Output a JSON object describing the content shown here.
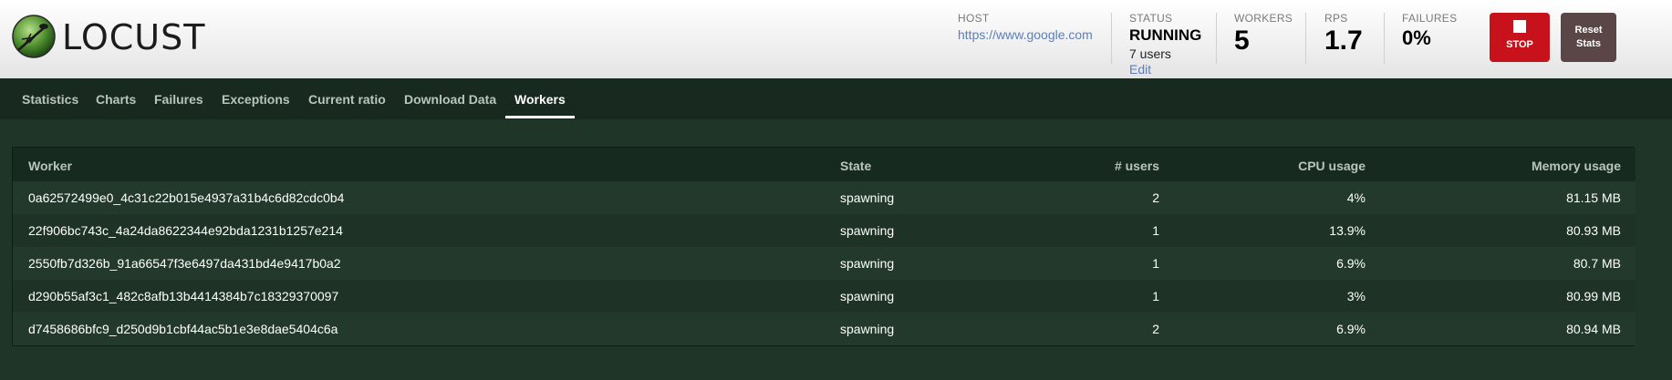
{
  "app": {
    "logo_text": "LOCUST"
  },
  "header": {
    "host": {
      "label": "HOST",
      "value": "https://www.google.com"
    },
    "status": {
      "label": "STATUS",
      "value": "RUNNING",
      "users": "7 users",
      "edit": "Edit"
    },
    "workers": {
      "label": "WORKERS",
      "value": "5"
    },
    "rps": {
      "label": "RPS",
      "value": "1.7"
    },
    "failures": {
      "label": "FAILURES",
      "value": "0%"
    },
    "stop_label": "STOP",
    "reset_label_line1": "Reset",
    "reset_label_line2": "Stats"
  },
  "colors": {
    "stop": "#c8121b",
    "reset": "#5a4646",
    "link": "#5c7fb8",
    "background": "#1f3528"
  },
  "tabs": [
    {
      "label": "Statistics"
    },
    {
      "label": "Charts"
    },
    {
      "label": "Failures"
    },
    {
      "label": "Exceptions"
    },
    {
      "label": "Current ratio"
    },
    {
      "label": "Download Data"
    },
    {
      "label": "Workers",
      "active": true
    }
  ],
  "table": {
    "columns": [
      "Worker",
      "State",
      "# users",
      "CPU usage",
      "Memory usage"
    ],
    "rows": [
      [
        "0a62572499e0_4c31c22b015e4937a31b4c6d82cdc0b4",
        "spawning",
        "2",
        "4%",
        "81.15 MB"
      ],
      [
        "22f906bc743c_4a24da8622344e92bda1231b1257e214",
        "spawning",
        "1",
        "13.9%",
        "80.93 MB"
      ],
      [
        "2550fb7d326b_91a66547f3e6497da431bd4e9417b0a2",
        "spawning",
        "1",
        "6.9%",
        "80.7 MB"
      ],
      [
        "d290b55af3c1_482c8afb13b4414384b7c18329370097",
        "spawning",
        "1",
        "3%",
        "80.99 MB"
      ],
      [
        "d7458686bfc9_d250d9b1cbf44ac5b1e3e8dae5404c6a",
        "spawning",
        "2",
        "6.9%",
        "80.94 MB"
      ]
    ]
  }
}
